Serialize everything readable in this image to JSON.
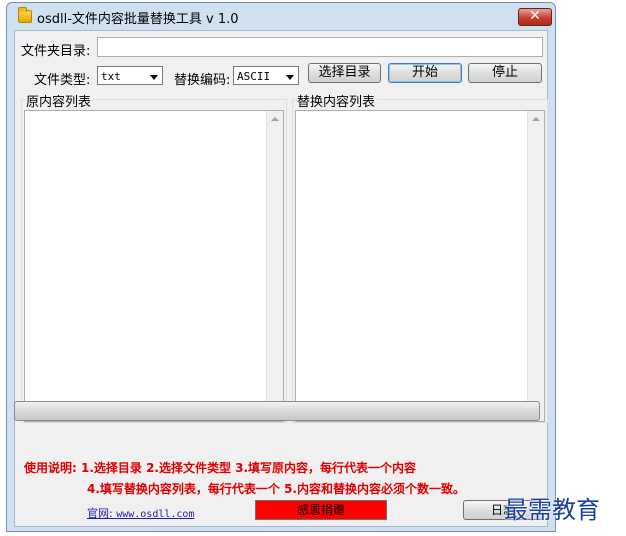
{
  "window": {
    "title": "osdll-文件内容批量替换工具 v 1.0",
    "close_symbol": "✕"
  },
  "form": {
    "folder_label": "文件夹目录:",
    "folder_value": "",
    "filetype_label": "文件类型:",
    "filetype_value": "txt",
    "encoding_label": "替换编码:",
    "encoding_value": "ASCII",
    "select_dir_label": "选择目录",
    "start_label": "开始",
    "stop_label": "停止"
  },
  "lists": {
    "original_title": "原内容列表",
    "replace_title": "替换内容列表"
  },
  "progress": {
    "value": 0
  },
  "usage": {
    "line1": "使用说明: 1.选择目录   2.选择文件类型   3.填写原内容，每行代表一个内容",
    "line2": "4.填写替换内容列表，每行代表一个   5.内容和替换内容必须个数一致。"
  },
  "footer": {
    "site_prefix": "官网: ",
    "site_url": "www.osdll.com",
    "donate_label": "感恩捐赠",
    "log_label": "日志"
  },
  "watermark": "最需教育"
}
